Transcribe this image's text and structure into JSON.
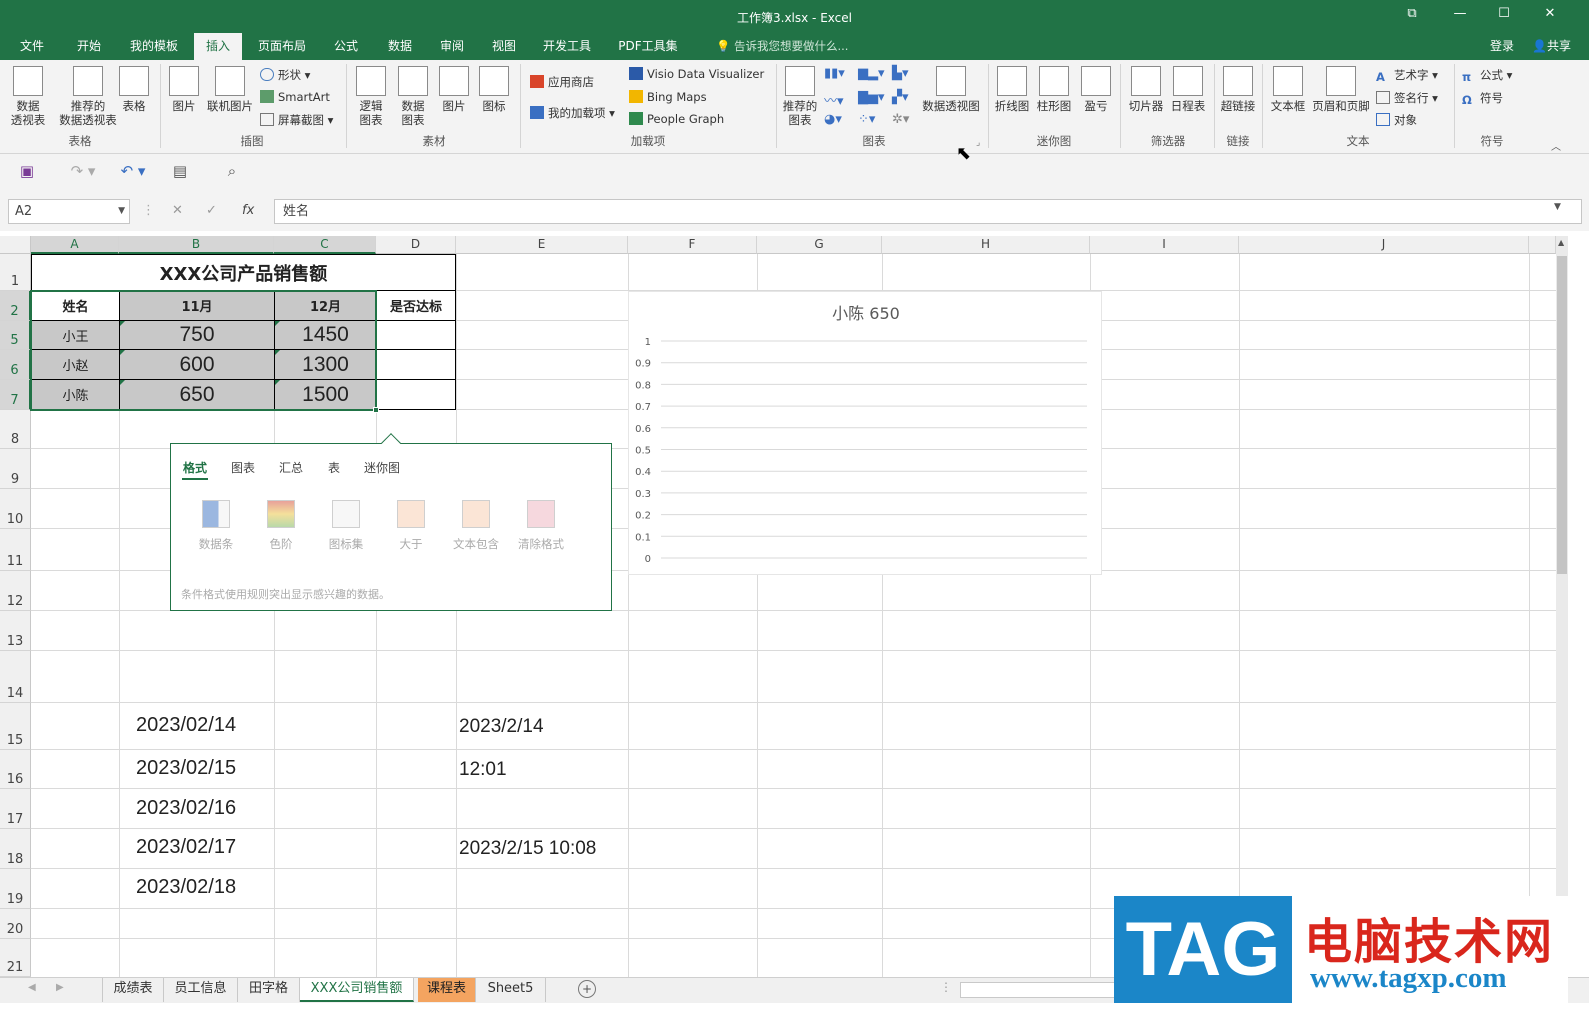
{
  "window": {
    "title": "工作簿3.xlsx - Excel",
    "restore": "⧉",
    "minimize": "—",
    "maximize": "☐",
    "close": "✕"
  },
  "tabs": [
    {
      "label": "文件",
      "active": false
    },
    {
      "label": "开始",
      "active": false
    },
    {
      "label": "我的模板",
      "active": false
    },
    {
      "label": "插入",
      "active": true
    },
    {
      "label": "页面布局",
      "active": false
    },
    {
      "label": "公式",
      "active": false
    },
    {
      "label": "数据",
      "active": false
    },
    {
      "label": "审阅",
      "active": false
    },
    {
      "label": "视图",
      "active": false
    },
    {
      "label": "开发工具",
      "active": false
    },
    {
      "label": "PDF工具集",
      "active": false
    }
  ],
  "tell_me": "告诉我您想要做什么...",
  "login": "登录",
  "share": "共享",
  "ribbon": {
    "pivot": "数据\n透视表",
    "rec_pivot": "推荐的\n数据透视表",
    "table": "表格",
    "group_table": "表格",
    "picture": "图片",
    "online_picture": "联机图片",
    "shapes": "形状",
    "smartart": "SmartArt",
    "screenshot": "屏幕截图",
    "group_illustrations": "插图",
    "logic_chart": "逻辑\n图表",
    "data_chart": "数据\n图表",
    "img": "图片",
    "icon": "图标",
    "group_material": "素材",
    "store": "应用商店",
    "my_addins": "我的加载项",
    "visio": "Visio Data Visualizer",
    "bing": "Bing Maps",
    "people": "People Graph",
    "group_addins": "加载项",
    "rec_chart": "推荐的\n图表",
    "pivot_chart": "数据透视图",
    "group_charts": "图表",
    "line": "折线图",
    "column": "柱形图",
    "winloss": "盈亏",
    "group_sparkline": "迷你图",
    "slicer": "切片器",
    "timeline": "日程表",
    "group_filter": "筛选器",
    "hyperlink": "超链接",
    "group_link": "链接",
    "textbox": "文本框",
    "header_footer": "页眉和页脚",
    "wordart": "艺术字",
    "signature": "签名行",
    "object": "对象",
    "group_text": "文本",
    "equation": "公式",
    "symbol": "符号",
    "group_symbols": "符号"
  },
  "namebox": "A2",
  "formula": "姓名",
  "columns": [
    "A",
    "B",
    "C",
    "D",
    "E",
    "F",
    "G",
    "H",
    "I",
    "J"
  ],
  "rows": [
    "1",
    "2",
    "5",
    "6",
    "7",
    "8",
    "9",
    "10",
    "11",
    "12",
    "13",
    "14",
    "15",
    "16",
    "17",
    "18",
    "19",
    "20",
    "21"
  ],
  "table": {
    "title": "XXX公司产品销售额",
    "headers": [
      "姓名",
      "11月",
      "12月",
      "是否达标"
    ],
    "data": [
      {
        "name": "小王",
        "nov": "750",
        "dec": "1450"
      },
      {
        "name": "小赵",
        "nov": "600",
        "dec": "1300"
      },
      {
        "name": "小陈",
        "nov": "650",
        "dec": "1500"
      }
    ]
  },
  "dates_b": [
    "2023/02/14",
    "2023/02/15",
    "2023/02/16",
    "2023/02/17",
    "2023/02/18"
  ],
  "col_e": {
    "r15": "2023/2/14",
    "r16": "12:01",
    "r18": "2023/2/15 10:08"
  },
  "chart_data": {
    "type": "bar",
    "title": "小陈 650",
    "ylim": [
      0,
      1
    ],
    "yticks": [
      "1",
      "0.9",
      "0.8",
      "0.7",
      "0.6",
      "0.5",
      "0.4",
      "0.3",
      "0.2",
      "0.1",
      "0"
    ],
    "series": [],
    "grid": true
  },
  "quick_analysis": {
    "tabs": [
      "格式",
      "图表",
      "汇总",
      "表",
      "迷你图"
    ],
    "items": [
      "数据条",
      "色阶",
      "图标集",
      "大于",
      "文本包含",
      "清除格式"
    ],
    "hint": "条件格式使用规则突出显示感兴趣的数据。"
  },
  "sheets": [
    {
      "label": "成绩表",
      "state": "normal"
    },
    {
      "label": "员工信息",
      "state": "normal"
    },
    {
      "label": "田字格",
      "state": "normal"
    },
    {
      "label": "XXX公司销售额",
      "state": "active"
    },
    {
      "label": "课程表",
      "state": "orange"
    },
    {
      "label": "Sheet5",
      "state": "normal"
    }
  ],
  "watermark": {
    "logo": "TAG",
    "cn": "电脑技术网",
    "url": "www.tagxp.com"
  },
  "colors": {
    "excel_green": "#217346",
    "orange_tab": "#f4a460",
    "watermark_blue": "#1b86c8",
    "watermark_red": "#d9261c"
  }
}
